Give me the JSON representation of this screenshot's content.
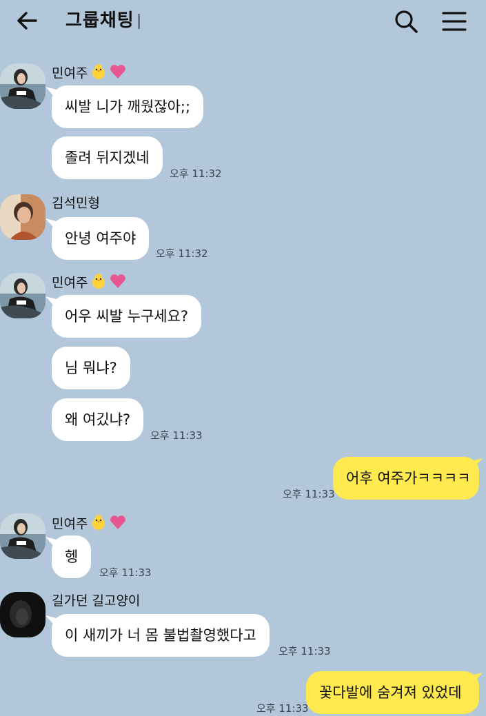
{
  "header": {
    "title": "그룹채팅",
    "back_icon": "arrow-left-icon",
    "search_icon": "search-icon",
    "menu_icon": "hamburger-menu-icon"
  },
  "colors": {
    "background": "#b2c7da",
    "bubble_other": "#ffffff",
    "bubble_mine": "#fee94f"
  },
  "messages": {
    "g1": {
      "sender": "민여주",
      "sender_emoji": [
        "chick-emoji",
        "pink-heart-emoji"
      ],
      "bubbles": [
        "씨발 니가 깨웠잖아;;",
        "졸려 뒤지겠네"
      ],
      "time": "오후 11:32"
    },
    "g2": {
      "sender": "김석민형",
      "bubbles": [
        "안녕 여주야"
      ],
      "time": "오후 11:32"
    },
    "g3": {
      "sender": "민여주",
      "sender_emoji": [
        "chick-emoji",
        "pink-heart-emoji"
      ],
      "bubbles": [
        "어우 씨발 누구세요?",
        "님 뭐냐?",
        "왜 여깄냐?"
      ],
      "time": "오후 11:33"
    },
    "g4": {
      "bubbles": [
        "어후 여주가ㅋㅋㅋㅋ"
      ],
      "time": "오후 11:33"
    },
    "g5": {
      "sender": "민여주",
      "sender_emoji": [
        "chick-emoji",
        "pink-heart-emoji"
      ],
      "bubbles": [
        "헹"
      ],
      "time": "오후 11:33"
    },
    "g6": {
      "sender": "길가던 길고양이",
      "bubbles": [
        "이 새끼가 너 몸 불법촬영했다고"
      ],
      "time": "오후 11:33"
    },
    "g7": {
      "bubbles": [
        "꽃다발에 숨겨져 있었데"
      ],
      "time": "오후 11:33"
    }
  }
}
